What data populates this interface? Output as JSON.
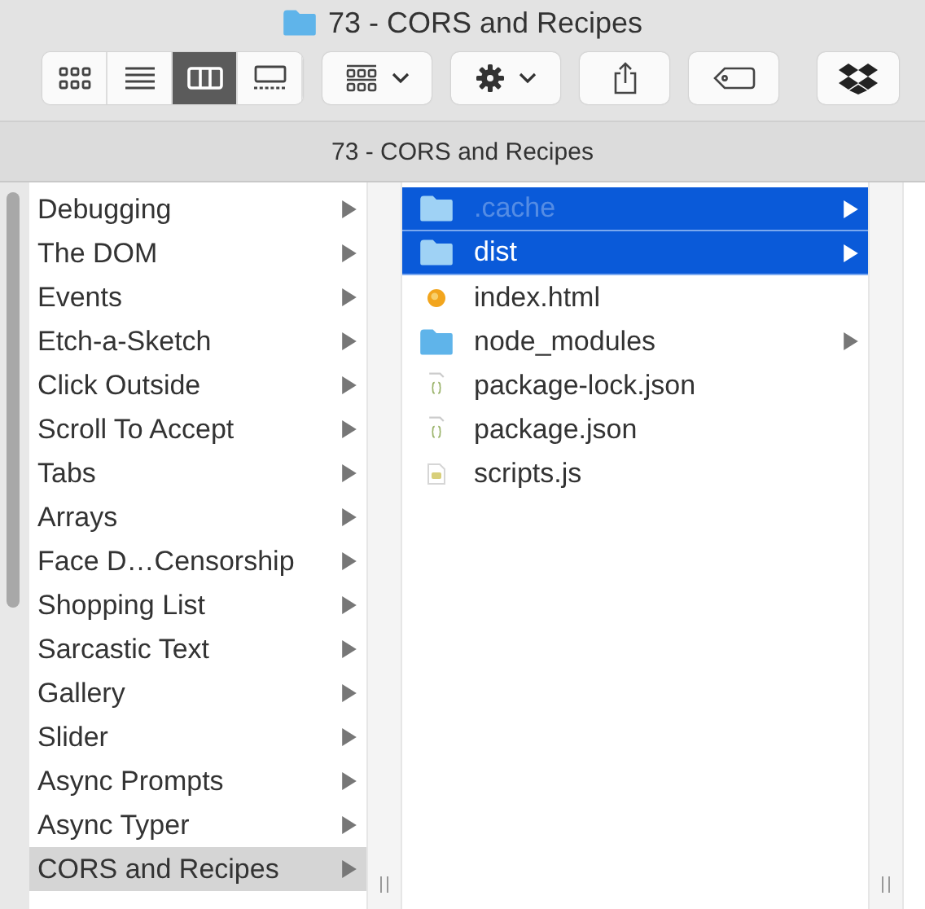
{
  "window": {
    "title": "73 - CORS and Recipes"
  },
  "toolbar": {
    "view_modes": [
      {
        "kind": "icons",
        "selected": false
      },
      {
        "kind": "list",
        "selected": false
      },
      {
        "kind": "columns",
        "selected": true
      },
      {
        "kind": "gallery",
        "selected": false
      }
    ],
    "buttons": [
      {
        "kind": "group",
        "dropdown": true
      },
      {
        "kind": "action",
        "dropdown": true
      },
      {
        "kind": "share",
        "dropdown": false
      },
      {
        "kind": "tag",
        "dropdown": false
      },
      {
        "kind": "dropbox",
        "dropdown": false
      }
    ]
  },
  "path_bar": {
    "title": "73 - CORS and Recipes"
  },
  "columns": [
    {
      "active": false,
      "items": [
        {
          "name": "Debugging",
          "selected": false,
          "has_children": true
        },
        {
          "name": "The DOM",
          "selected": false,
          "has_children": true
        },
        {
          "name": "Events",
          "selected": false,
          "has_children": true
        },
        {
          "name": "Etch-a-Sketch",
          "selected": false,
          "has_children": true
        },
        {
          "name": "Click Outside",
          "selected": false,
          "has_children": true
        },
        {
          "name": "Scroll To Accept",
          "selected": false,
          "has_children": true
        },
        {
          "name": "Tabs",
          "selected": false,
          "has_children": true
        },
        {
          "name": "Arrays",
          "selected": false,
          "has_children": true
        },
        {
          "name": "Face D…Censorship",
          "selected": false,
          "has_children": true
        },
        {
          "name": "Shopping List",
          "selected": false,
          "has_children": true
        },
        {
          "name": "Sarcastic Text",
          "selected": false,
          "has_children": true
        },
        {
          "name": "Gallery",
          "selected": false,
          "has_children": true
        },
        {
          "name": "Slider",
          "selected": false,
          "has_children": true
        },
        {
          "name": "Async Prompts",
          "selected": false,
          "has_children": true
        },
        {
          "name": "Async Typer",
          "selected": false,
          "has_children": true
        },
        {
          "name": "CORS and Recipes",
          "selected": true,
          "has_children": true
        }
      ]
    },
    {
      "active": true,
      "items": [
        {
          "name": ".cache",
          "kind": "folder",
          "selected": true,
          "has_children": true,
          "hidden": true
        },
        {
          "name": "dist",
          "kind": "folder",
          "selected": true,
          "has_children": true,
          "hidden": false
        },
        {
          "name": "index.html",
          "kind": "html",
          "selected": false,
          "has_children": false,
          "hidden": false
        },
        {
          "name": "node_modules",
          "kind": "folder",
          "selected": false,
          "has_children": true,
          "hidden": false
        },
        {
          "name": "package-lock.json",
          "kind": "json",
          "selected": false,
          "has_children": false,
          "hidden": false
        },
        {
          "name": "package.json",
          "kind": "json",
          "selected": false,
          "has_children": false,
          "hidden": false
        },
        {
          "name": "scripts.js",
          "kind": "js",
          "selected": false,
          "has_children": false,
          "hidden": false
        }
      ]
    }
  ]
}
